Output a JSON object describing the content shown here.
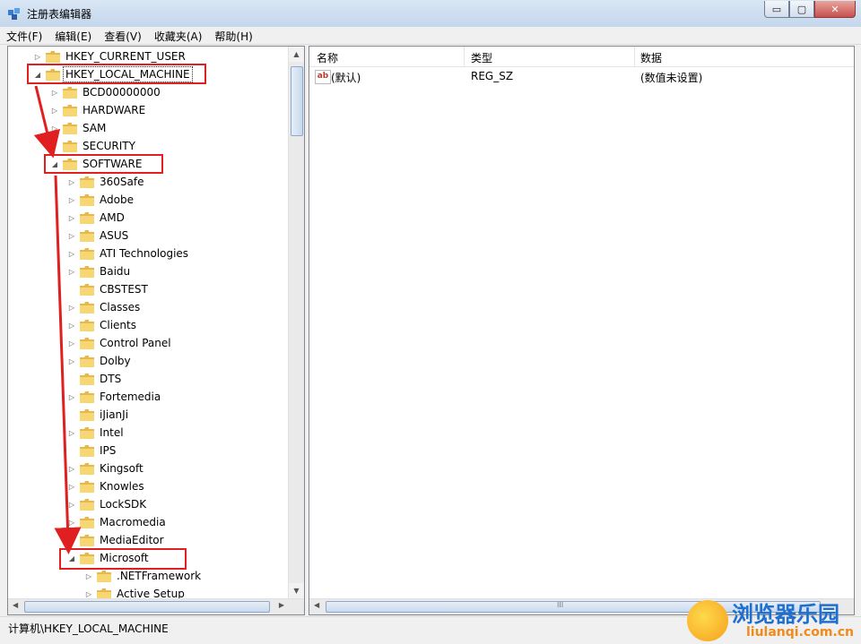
{
  "window": {
    "title": "注册表编辑器",
    "buttons": {
      "minimize": "▭",
      "maximize": "▢",
      "close": "✕"
    }
  },
  "menu": [
    "文件(F)",
    "编辑(E)",
    "查看(V)",
    "收藏夹(A)",
    "帮助(H)"
  ],
  "tree": {
    "root_items": [
      {
        "label": "HKEY_CURRENT_USER",
        "expander": "▷"
      },
      {
        "label": "HKEY_LOCAL_MACHINE",
        "expander": "◢"
      }
    ],
    "hklm_children": [
      {
        "label": "BCD00000000",
        "expander": "▷"
      },
      {
        "label": "HARDWARE",
        "expander": "▷"
      },
      {
        "label": "SAM",
        "expander": "▷"
      },
      {
        "label": "SECURITY",
        "expander": ""
      },
      {
        "label": "SOFTWARE",
        "expander": "◢"
      }
    ],
    "software_children": [
      {
        "label": "360Safe",
        "expander": "▷"
      },
      {
        "label": "Adobe",
        "expander": "▷"
      },
      {
        "label": "AMD",
        "expander": "▷"
      },
      {
        "label": "ASUS",
        "expander": "▷"
      },
      {
        "label": "ATI Technologies",
        "expander": "▷"
      },
      {
        "label": "Baidu",
        "expander": "▷"
      },
      {
        "label": "CBSTEST",
        "expander": ""
      },
      {
        "label": "Classes",
        "expander": "▷"
      },
      {
        "label": "Clients",
        "expander": "▷"
      },
      {
        "label": "Control Panel",
        "expander": "▷"
      },
      {
        "label": "Dolby",
        "expander": "▷"
      },
      {
        "label": "DTS",
        "expander": ""
      },
      {
        "label": "Fortemedia",
        "expander": "▷"
      },
      {
        "label": "iJianJi",
        "expander": ""
      },
      {
        "label": "Intel",
        "expander": "▷"
      },
      {
        "label": "IPS",
        "expander": ""
      },
      {
        "label": "Kingsoft",
        "expander": "▷"
      },
      {
        "label": "Knowles",
        "expander": "▷"
      },
      {
        "label": "LockSDK",
        "expander": "▷"
      },
      {
        "label": "Macromedia",
        "expander": "▷"
      },
      {
        "label": "MediaEditor",
        "expander": ""
      },
      {
        "label": "Microsoft",
        "expander": "◢"
      }
    ],
    "microsoft_children": [
      {
        "label": ".NETFramework",
        "expander": "▷"
      },
      {
        "label": "Active Setup",
        "expander": "▷"
      }
    ]
  },
  "list": {
    "columns": [
      "名称",
      "类型",
      "数据"
    ],
    "rows": [
      {
        "icon": "ab",
        "name": "(默认)",
        "type": "REG_SZ",
        "data": "(数值未设置)"
      }
    ]
  },
  "status": {
    "path": "计算机\\HKEY_LOCAL_MACHINE"
  },
  "scrollbar_glyphs": {
    "up": "▲",
    "down": "▼",
    "left": "◀",
    "right": "▶",
    "grip": "III"
  },
  "watermark": {
    "title": "浏览器乐园",
    "subtitle": "liulanqi.com.cn"
  },
  "colors": {
    "annotation": "#e02020",
    "watermark_blue": "#1f6fd1",
    "watermark_orange": "#f08a1a"
  }
}
